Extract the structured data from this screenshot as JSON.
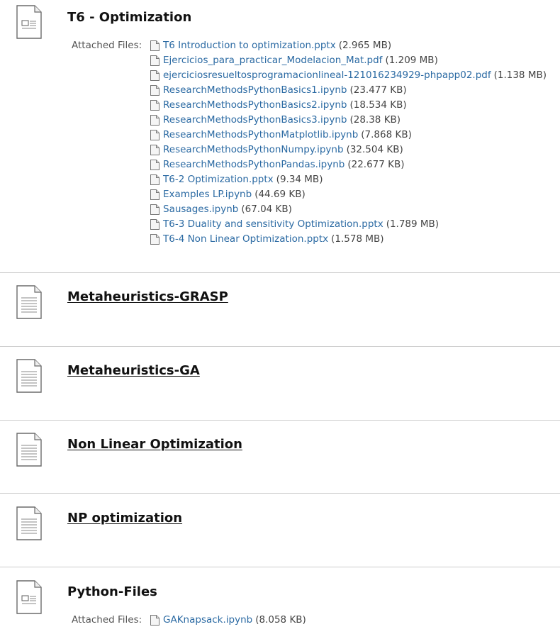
{
  "sections": [
    {
      "title": "T6 - Optimization",
      "attached_label": "Attached Files:",
      "files": [
        {
          "name": "T6 Introduction to optimization.pptx",
          "size": "(2.965 MB)"
        },
        {
          "name": "Ejercicios_para_practicar_Modelacion_Mat.pdf",
          "size": "(1.209 MB)"
        },
        {
          "name": "ejerciciosresueltosprogramacionlineal-121016234929-phpapp02.pdf",
          "size": "(1.138 MB)"
        },
        {
          "name": "ResearchMethodsPythonBasics1.ipynb",
          "size": "(23.477 KB)"
        },
        {
          "name": "ResearchMethodsPythonBasics2.ipynb",
          "size": "(18.534 KB)"
        },
        {
          "name": "ResearchMethodsPythonBasics3.ipynb",
          "size": "(28.38 KB)"
        },
        {
          "name": "ResearchMethodsPythonMatplotlib.ipynb",
          "size": "(7.868 KB)"
        },
        {
          "name": "ResearchMethodsPythonNumpy.ipynb",
          "size": "(32.504 KB)"
        },
        {
          "name": "ResearchMethodsPythonPandas.ipynb",
          "size": "(22.677 KB)"
        },
        {
          "name": "T6-2 Optimization.pptx",
          "size": "(9.34 MB)"
        },
        {
          "name": "Examples LP.ipynb",
          "size": "(44.69 KB)"
        },
        {
          "name": "Sausages.ipynb",
          "size": "(67.04 KB)"
        },
        {
          "name": "T6-3 Duality and sensitivity Optimization.pptx",
          "size": "(1.789 MB)"
        },
        {
          "name": "T6-4 Non Linear Optimization.pptx",
          "size": "(1.578 MB)"
        }
      ]
    },
    {
      "title": "Metaheuristics-GRASP"
    },
    {
      "title": "Metaheuristics-GA"
    },
    {
      "title": "Non Linear Optimization"
    },
    {
      "title": "NP optimization"
    },
    {
      "title": "Python-Files",
      "attached_label": "Attached Files:",
      "files": [
        {
          "name": "GAKnapsack.ipynb",
          "size": "(8.058 KB)"
        }
      ]
    }
  ]
}
